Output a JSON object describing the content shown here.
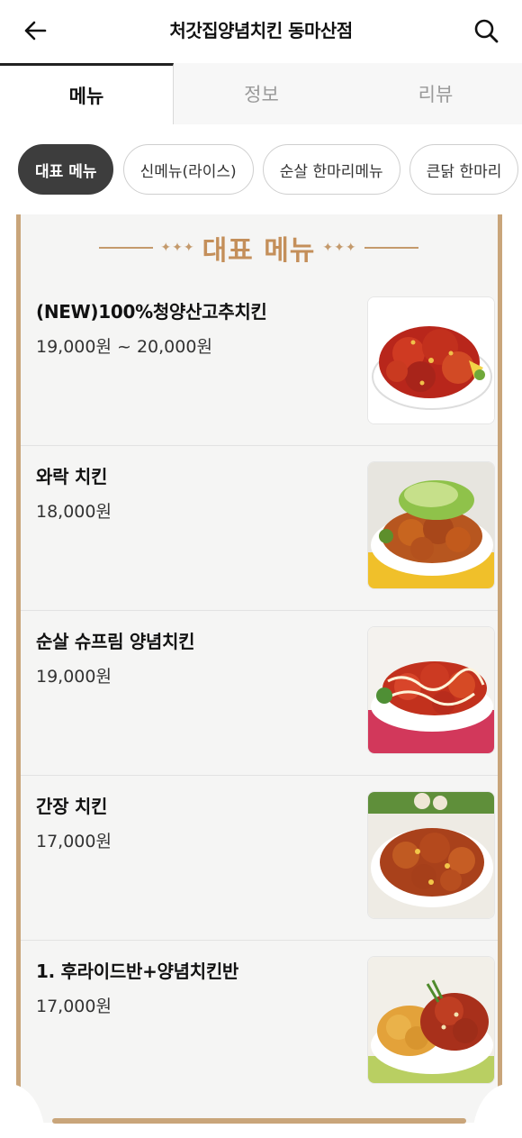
{
  "header": {
    "title": "처갓집양념치킨 동마산점",
    "back_icon": "arrow-left-icon",
    "search_icon": "search-icon"
  },
  "tabs": [
    {
      "label": "메뉴",
      "active": true
    },
    {
      "label": "정보",
      "active": false
    },
    {
      "label": "리뷰",
      "active": false
    }
  ],
  "categories": [
    {
      "label": "대표 메뉴",
      "active": true
    },
    {
      "label": "신메뉴(라이스)",
      "active": false
    },
    {
      "label": "순살 한마리메뉴",
      "active": false
    },
    {
      "label": "큰닭 한마리",
      "active": false
    }
  ],
  "section": {
    "title": "대표 메뉴",
    "deco": "✦✦✦"
  },
  "menu_items": [
    {
      "name": "(NEW)100%청양산고추치킨",
      "price": "19,000원 ~ 20,000원",
      "image_icon": "spicy-chicken-photo"
    },
    {
      "name": "와락 치킨",
      "price": "18,000원",
      "image_icon": "scallion-chicken-photo"
    },
    {
      "name": "순살 슈프림 양념치킨",
      "price": "19,000원",
      "image_icon": "supreme-chicken-photo"
    },
    {
      "name": "간장 치킨",
      "price": "17,000원",
      "image_icon": "soy-chicken-photo"
    },
    {
      "name": "1. 후라이드반+양념치킨반",
      "price": "17,000원",
      "image_icon": "half-half-chicken-photo"
    }
  ],
  "colors": {
    "accent_gold": "#c48f5a",
    "board_border": "#c9a57a",
    "active_chip": "#3d3d3d"
  }
}
